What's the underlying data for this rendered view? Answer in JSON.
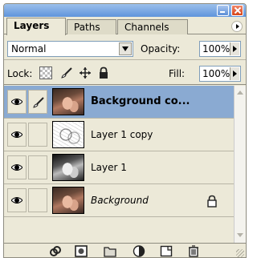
{
  "tabs": [
    {
      "label": "Layers",
      "active": true
    },
    {
      "label": "Paths",
      "active": false
    },
    {
      "label": "Channels",
      "active": false
    }
  ],
  "blend_mode": {
    "value": "Normal"
  },
  "opacity": {
    "label": "Opacity:",
    "value": "100%"
  },
  "lock": {
    "label": "Lock:"
  },
  "fill": {
    "label": "Fill:",
    "value": "100%"
  },
  "layers": [
    {
      "name": "Background co...",
      "selected": true,
      "visible": true,
      "thumbnail": "color-photo"
    },
    {
      "name": "Layer 1 copy",
      "selected": false,
      "visible": true,
      "thumbnail": "sketch"
    },
    {
      "name": "Layer 1",
      "selected": false,
      "visible": true,
      "thumbnail": "bw-photo"
    },
    {
      "name": "Background",
      "selected": false,
      "visible": true,
      "locked": true,
      "thumbnail": "color-photo"
    }
  ],
  "bottom_icons": [
    "link-layers-icon",
    "add-layer-mask-icon",
    "new-group-icon",
    "adjustment-layer-icon",
    "new-layer-icon",
    "trash-icon"
  ],
  "colors": {
    "selected_row": "#8aaad2",
    "panel_bg": "#ece9d8",
    "title_bar": "#5f94dc",
    "close_button": "#d64416"
  }
}
